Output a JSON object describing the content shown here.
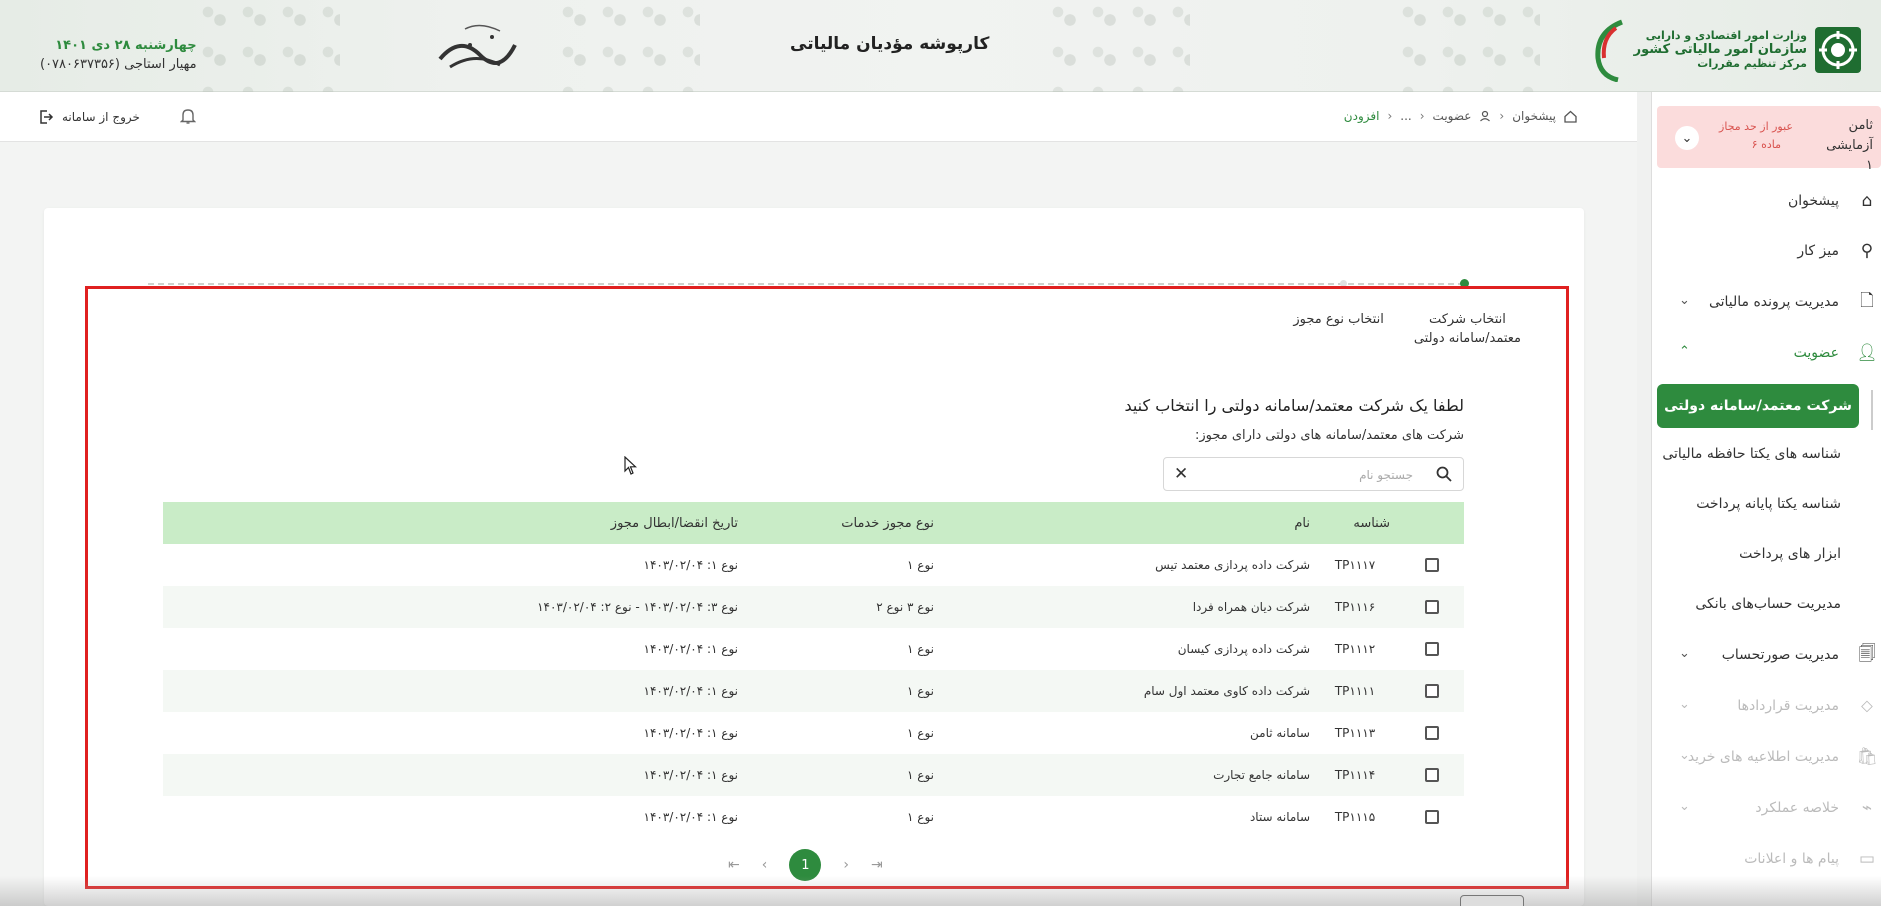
{
  "header": {
    "app_title": "کارپوشه مؤدیان مالیاتی",
    "date": "چهارشنبه ۲۸ دی ۱۴۰۱",
    "user": "مهیار استاجی (۰۷۸۰۶۳۷۳۵۶)",
    "logo_lines": [
      "وزارت امور اقتصادی و دارایی",
      "سازمان امور مالیاتی کشور",
      "مرکز تنظیم مقررات"
    ],
    "brand_color": "#2e8b3e"
  },
  "alert": {
    "name": "ثامن آزمایشی ۱",
    "message_line1": "عبور از حد مجاز",
    "message_line2": "ماده ۶"
  },
  "sidebar": {
    "items": [
      {
        "label": "پیشخوان",
        "icon": "home-icon"
      },
      {
        "label": "میز کار",
        "icon": "workspace-icon"
      },
      {
        "label": "مدیریت پرونده مالیاتی",
        "icon": "file-icon"
      },
      {
        "label": "عضویت",
        "icon": "user-icon"
      },
      {
        "label": "مدیریت صورتحساب",
        "icon": "invoice-icon"
      },
      {
        "label": "مدیریت قراردادها",
        "icon": "contract-icon"
      },
      {
        "label": "مدیریت اطلاعیه های خرید",
        "icon": "purchase-icon"
      },
      {
        "label": "خلاصه عملکرد",
        "icon": "summary-icon"
      },
      {
        "label": "پیام ها و اعلانات",
        "icon": "message-icon"
      }
    ],
    "submenu": [
      "شرکت معتمد/سامانه دولتی",
      "شناسه های یکتا حافظه مالیاتی",
      "شناسه یکتا پایانه پرداخت",
      "ابزار های پرداخت",
      "مدیریت حساب‌های بانکی"
    ]
  },
  "navbar": {
    "logout_label": "خروج از سامانه",
    "breadcrumb": [
      "پیشخوان",
      "عضویت",
      "...",
      "افزودن"
    ]
  },
  "wizard": {
    "steps": [
      {
        "line1": "انتخاب شرکت",
        "line2": "معتمد/سامانه دولتی"
      },
      {
        "line1": "انتخاب نوع مجوز",
        "line2": ""
      }
    ],
    "title": "لطفا یک شرکت معتمد/سامانه دولتی را انتخاب کنید",
    "subtitle": "شرکت های معتمد/سامانه های دولتی دارای مجوز:"
  },
  "search": {
    "placeholder": "جستجو نام",
    "value": ""
  },
  "table": {
    "columns": [
      "شناسه",
      "نام",
      "نوع مجوز خدمات",
      "تاریخ انقضا/ابطال مجوز"
    ],
    "rows": [
      {
        "id": "TP۱۱۱۷",
        "name": "شرکت داده پردازی معتمد تیس",
        "type": "نوع ۱",
        "date": "نوع ۱: ۱۴۰۳/۰۲/۰۴"
      },
      {
        "id": "TP۱۱۱۶",
        "name": "شرکت دیان همراه فردا",
        "type": "نوع ۳   نوع ۲",
        "date": "نوع ۳: ۱۴۰۳/۰۲/۰۴  -  نوع ۲: ۱۴۰۳/۰۲/۰۴"
      },
      {
        "id": "TP۱۱۱۲",
        "name": "شرکت داده پردازی کیسان",
        "type": "نوع ۱",
        "date": "نوع ۱: ۱۴۰۳/۰۲/۰۴"
      },
      {
        "id": "TP۱۱۱۱",
        "name": "شرکت داده کاوی معتمد اول سام",
        "type": "نوع ۱",
        "date": "نوع ۱: ۱۴۰۳/۰۲/۰۴"
      },
      {
        "id": "TP۱۱۱۳",
        "name": "سامانه ثامن",
        "type": "نوع ۱",
        "date": "نوع ۱: ۱۴۰۳/۰۲/۰۴"
      },
      {
        "id": "TP۱۱۱۴",
        "name": "سامانه جامع تجارت",
        "type": "نوع ۱",
        "date": "نوع ۱: ۱۴۰۳/۰۲/۰۴"
      },
      {
        "id": "TP۱۱۱۵",
        "name": "سامانه ستاد",
        "type": "نوع ۱",
        "date": "نوع ۱: ۱۴۰۳/۰۲/۰۴"
      }
    ]
  },
  "pagination": {
    "current_page": "1"
  }
}
